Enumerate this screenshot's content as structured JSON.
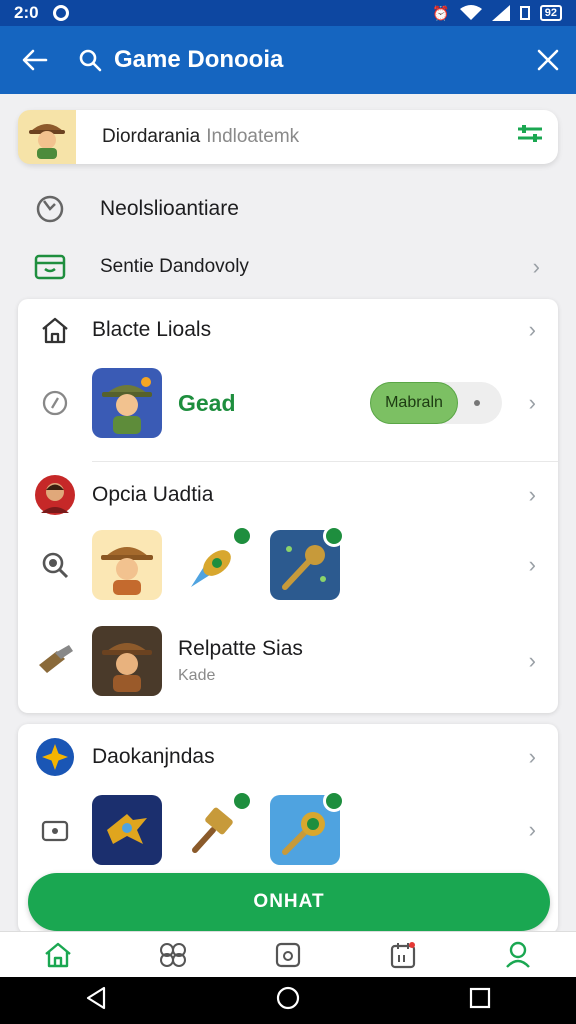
{
  "status": {
    "time": "2:0",
    "battery": "92"
  },
  "app_bar": {
    "title": "Game Donooia"
  },
  "search": {
    "query": "Diordarania",
    "placeholder": "Indloatemk"
  },
  "rows": {
    "row1_label": "Neolslioantiare",
    "row2_label": "Sentie Dandovoly"
  },
  "card1": {
    "header_label": "Blacte Lioals",
    "gead_label": "Gead",
    "toggle_label": "Mabraln",
    "opcia_label": "Opcia Uadtia",
    "relpatte_title": "Relpatte Sias",
    "relpatte_sub": "Kade"
  },
  "card2": {
    "header_label": "Daokanjndas"
  },
  "primary_button": {
    "label": "ONHAT"
  },
  "colors": {
    "primary": "#1565c0",
    "accent_green": "#1aa751",
    "toggle_green": "#7cc063"
  },
  "icons": {
    "back": "arrow-left-icon",
    "search": "search-icon",
    "close": "close-icon",
    "filter": "filter-icon",
    "nav": [
      "home-icon",
      "games-icon",
      "box-icon",
      "calendar-icon",
      "profile-icon"
    ]
  }
}
